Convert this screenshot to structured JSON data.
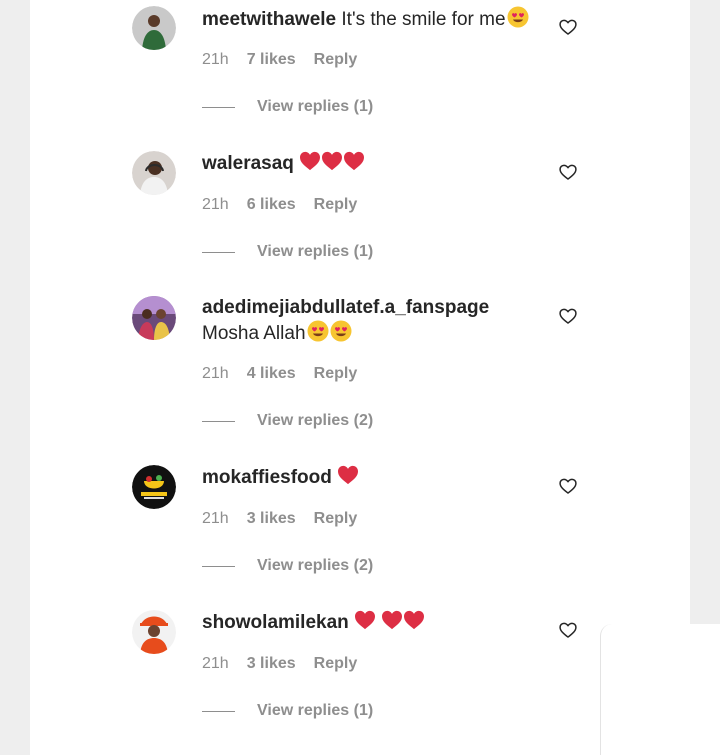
{
  "comments": [
    {
      "username": "meetwithawele",
      "text": "It's the smile for me",
      "emojis": [
        "heart-eyes-emoji"
      ],
      "time": "21h",
      "likes": "7 likes",
      "reply": "Reply",
      "view_replies": "View replies (1)"
    },
    {
      "username": "walerasaq",
      "text": "",
      "emojis": [
        "red-heart-emoji",
        "red-heart-emoji",
        "red-heart-emoji"
      ],
      "time": "21h",
      "likes": "6 likes",
      "reply": "Reply",
      "view_replies": "View replies (1)"
    },
    {
      "username": "adedimejiabdullatef.a_fanspage",
      "text": "Mosha Allah",
      "emojis": [
        "heart-eyes-emoji",
        "heart-eyes-emoji"
      ],
      "time": "21h",
      "likes": "4 likes",
      "reply": "Reply",
      "view_replies": "View replies (2)"
    },
    {
      "username": "mokaffiesfood",
      "text": "",
      "emojis": [
        "red-heart-emoji"
      ],
      "time": "21h",
      "likes": "3 likes",
      "reply": "Reply",
      "view_replies": "View replies (2)"
    },
    {
      "username": "showolamilekan",
      "text": "",
      "emojis": [
        "red-heart-emoji",
        "red-heart-emoji",
        "red-heart-emoji"
      ],
      "time": "21h",
      "likes": "3 likes",
      "reply": "Reply",
      "view_replies": "View replies (1)"
    }
  ],
  "icons": {
    "like": "heart-outline-icon"
  },
  "colors": {
    "text": "#262626",
    "secondary": "#8e8e8e",
    "heart": "#e0245e",
    "background": "#ffffff"
  }
}
